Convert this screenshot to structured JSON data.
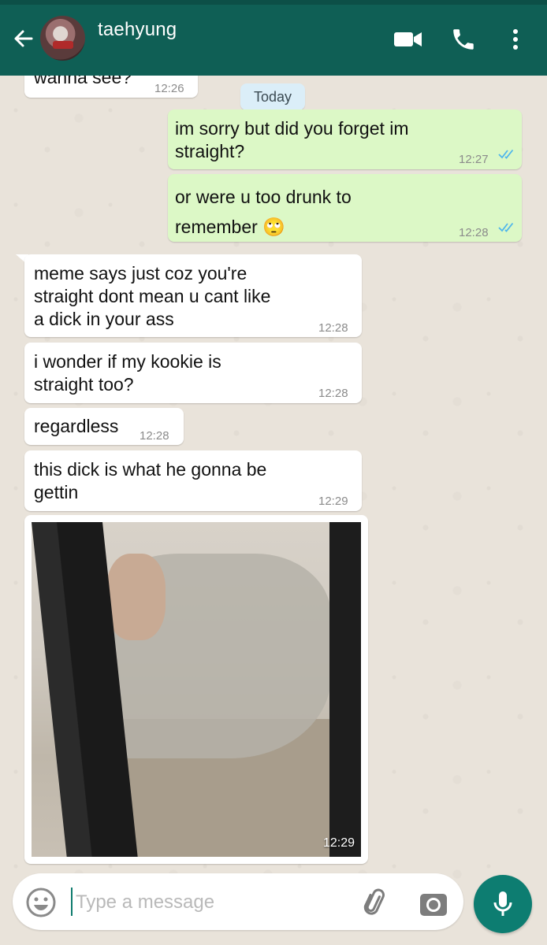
{
  "header": {
    "contact_name": "taehyung",
    "accent_color": "#0f5f55",
    "icons": [
      "back-arrow-icon",
      "video-call-icon",
      "phone-icon",
      "more-vert-icon"
    ]
  },
  "date_separator": "Today",
  "messages": [
    {
      "direction": "in",
      "text": "wanna see?",
      "time": "12:26"
    },
    {
      "direction": "out",
      "lines": [
        "im sorry but did you forget im",
        "straight?"
      ],
      "time": "12:27",
      "status": "read"
    },
    {
      "direction": "out",
      "lines": [
        "or were u too drunk to",
        "remember 🙄"
      ],
      "time": "12:28",
      "status": "read"
    },
    {
      "direction": "in",
      "lines": [
        "meme says just coz you're",
        "straight dont mean u cant like",
        "a dick in your ass"
      ],
      "time": "12:28"
    },
    {
      "direction": "in",
      "lines": [
        "i wonder if my kookie is",
        "straight too?"
      ],
      "time": "12:28"
    },
    {
      "direction": "in",
      "text": "regardless",
      "time": "12:28"
    },
    {
      "direction": "in",
      "lines": [
        "this dick is what he gonna be",
        "gettin"
      ],
      "time": "12:29"
    },
    {
      "direction": "in",
      "type": "image",
      "time": "12:29"
    }
  ],
  "composer": {
    "placeholder": "Type a message",
    "value": ""
  }
}
